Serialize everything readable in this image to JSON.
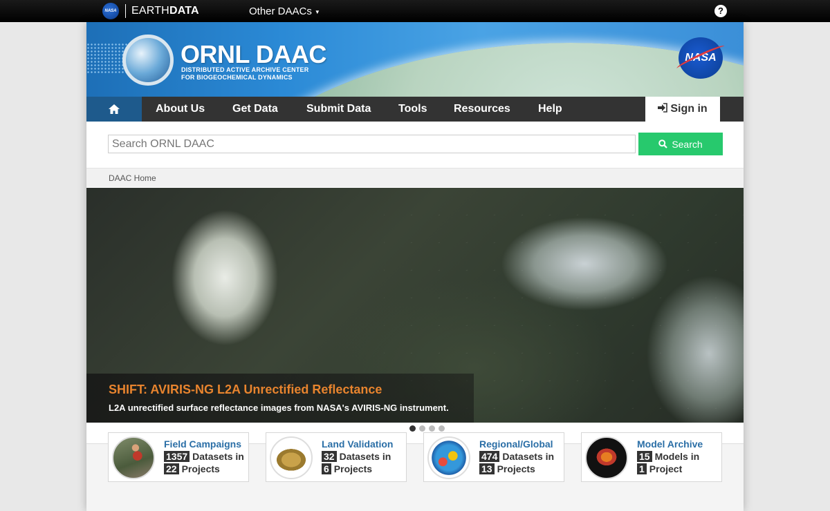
{
  "topbar": {
    "nasa_mini": "NASA",
    "earthdata_left": "EARTH",
    "earthdata_right": "DATA",
    "other_daacs": "Other DAACs",
    "help": "?"
  },
  "banner": {
    "title": "ORNL DAAC",
    "subtitle_line1": "DISTRIBUTED ACTIVE ARCHIVE CENTER",
    "subtitle_line2": "FOR BIOGEOCHEMICAL DYNAMICS",
    "nasa_logo": "NASA"
  },
  "nav": {
    "items": [
      "About Us",
      "Get Data",
      "Submit Data",
      "Tools",
      "Resources",
      "Help"
    ],
    "sign_in": "Sign in"
  },
  "search": {
    "placeholder": "Search ORNL DAAC",
    "button": "Search"
  },
  "breadcrumb": "DAAC Home",
  "hero": {
    "title": "SHIFT: AVIRIS-NG L2A Unrectified Reflectance",
    "subtitle": "L2A unrectified surface reflectance images from NASA's AVIRIS-NG instrument.",
    "slide_count": 4,
    "active_slide": 1
  },
  "cards": [
    {
      "title": "Field Campaigns",
      "n1": "1357",
      "t1": "Datasets in",
      "n2": "22",
      "t2": "Projects"
    },
    {
      "title": "Land Validation",
      "n1": "32",
      "t1": "Datasets in",
      "n2": "6",
      "t2": "Projects"
    },
    {
      "title": "Regional/Global",
      "n1": "474",
      "t1": "Datasets in",
      "n2": "13",
      "t2": "Projects"
    },
    {
      "title": "Model Archive",
      "n1": "15",
      "t1": "Models in",
      "n2": "1",
      "t2": "Project"
    }
  ],
  "colors": {
    "nav_bg": "#333333",
    "home_bg": "#1e5a8c",
    "search_button": "#27c96d",
    "hero_title": "#e8842e",
    "card_title": "#2a6ea6"
  }
}
